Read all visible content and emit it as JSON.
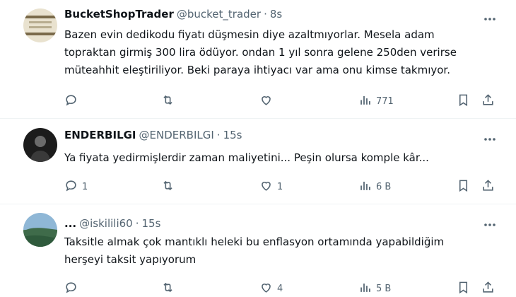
{
  "tweets": [
    {
      "name": "BucketShopTrader",
      "handle": "@bucket_trader",
      "separator": "·",
      "time": "8s",
      "text": "Bazen evin dedikodu fiyatı düşmesin diye azaltmıyorlar. Mesela adam\ntopraktan girmiş 300 lira ödüyor. ondan 1 yıl sonra gelene 250den verirse\nmüteahhit eleştiriliyor. Beki paraya ihtiyacı var ama onu kimse takmıyor.",
      "replies": "",
      "retweets": "",
      "likes": "",
      "views": "771"
    },
    {
      "name": "ENDERBILGI",
      "handle": "@ENDERBILGI",
      "separator": "·",
      "time": "15s",
      "text": "Ya fiyata yedirmişlerdir zaman maliyetini... Peşin olursa komple kâr...",
      "replies": "1",
      "retweets": "",
      "likes": "1",
      "views": "6 B"
    },
    {
      "name": "...",
      "handle": "@iskilili60",
      "separator": "·",
      "time": "15s",
      "text": "Taksitle almak çok mantıklı heleki bu enflasyon ortamında yapabildiğim\nherşeyi taksit yapıyorum",
      "replies": "",
      "retweets": "",
      "likes": "4",
      "views": "5 B"
    }
  ],
  "colors": {
    "muted": "#536471",
    "text": "#0f1419",
    "divider": "#eff3f4"
  },
  "icons": [
    "reply-icon",
    "retweet-icon",
    "like-icon",
    "views-icon",
    "bookmark-icon",
    "share-icon",
    "more-icon"
  ]
}
